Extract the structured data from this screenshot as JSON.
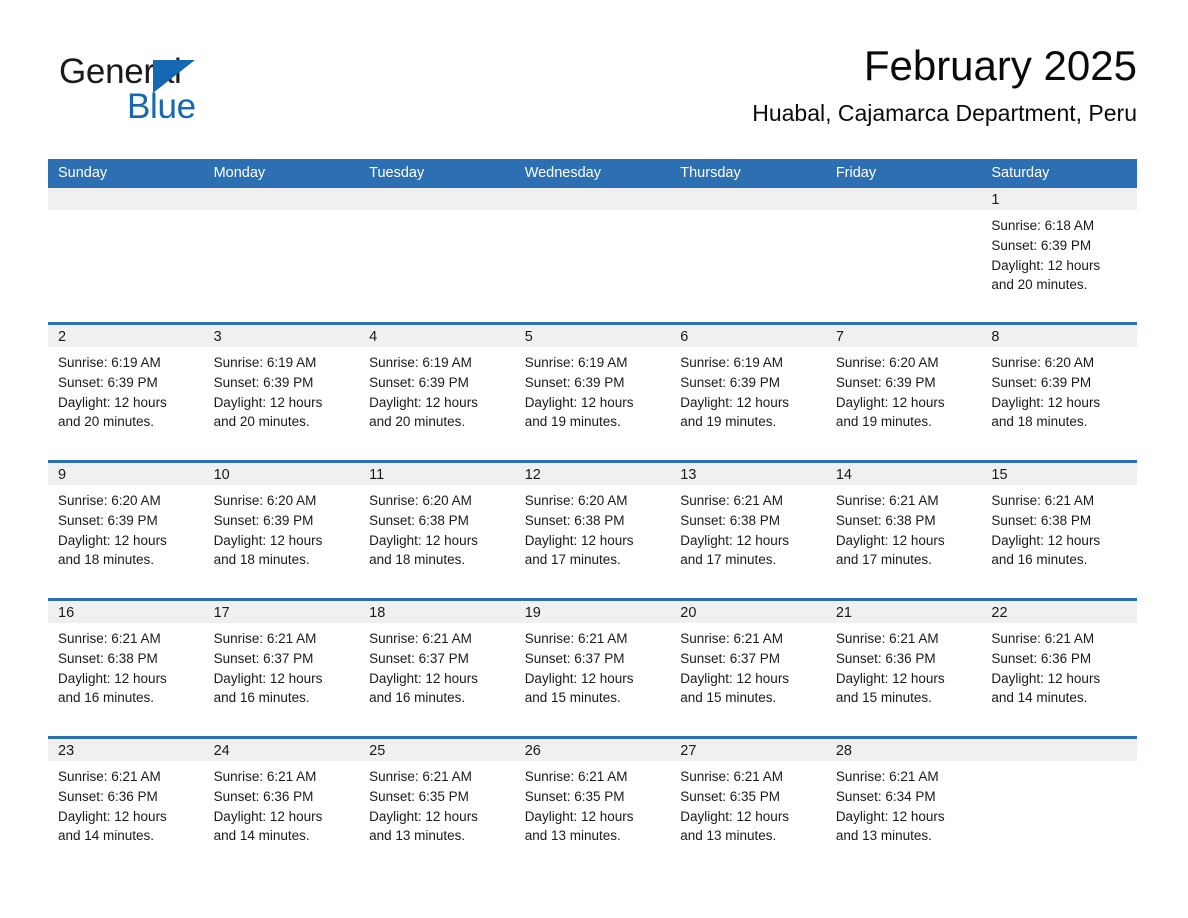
{
  "brand": {
    "name_part1": "General",
    "name_part2": "Blue",
    "triangle_color": "#1668b3"
  },
  "header": {
    "title": "February 2025",
    "subtitle": "Huabal, Cajamarca Department, Peru"
  },
  "theme": {
    "header_blue": "#2d6fb3",
    "daynum_band": "#f0f0f0",
    "text": "#1a1a1a",
    "page_background": "#ffffff"
  },
  "weekdays": [
    "Sunday",
    "Monday",
    "Tuesday",
    "Wednesday",
    "Thursday",
    "Friday",
    "Saturday"
  ],
  "labels": {
    "sunrise_prefix": "Sunrise:",
    "sunset_prefix": "Sunset:",
    "daylight_prefix": "Daylight:"
  },
  "weeks": [
    [
      {
        "day": "",
        "empty": true
      },
      {
        "day": "",
        "empty": true
      },
      {
        "day": "",
        "empty": true
      },
      {
        "day": "",
        "empty": true
      },
      {
        "day": "",
        "empty": true
      },
      {
        "day": "",
        "empty": true
      },
      {
        "day": "1",
        "sunrise": "Sunrise: 6:18 AM",
        "sunset": "Sunset: 6:39 PM",
        "daylight_line1": "Daylight: 12 hours",
        "daylight_line2": "and 20 minutes."
      }
    ],
    [
      {
        "day": "2",
        "sunrise": "Sunrise: 6:19 AM",
        "sunset": "Sunset: 6:39 PM",
        "daylight_line1": "Daylight: 12 hours",
        "daylight_line2": "and 20 minutes."
      },
      {
        "day": "3",
        "sunrise": "Sunrise: 6:19 AM",
        "sunset": "Sunset: 6:39 PM",
        "daylight_line1": "Daylight: 12 hours",
        "daylight_line2": "and 20 minutes."
      },
      {
        "day": "4",
        "sunrise": "Sunrise: 6:19 AM",
        "sunset": "Sunset: 6:39 PM",
        "daylight_line1": "Daylight: 12 hours",
        "daylight_line2": "and 20 minutes."
      },
      {
        "day": "5",
        "sunrise": "Sunrise: 6:19 AM",
        "sunset": "Sunset: 6:39 PM",
        "daylight_line1": "Daylight: 12 hours",
        "daylight_line2": "and 19 minutes."
      },
      {
        "day": "6",
        "sunrise": "Sunrise: 6:19 AM",
        "sunset": "Sunset: 6:39 PM",
        "daylight_line1": "Daylight: 12 hours",
        "daylight_line2": "and 19 minutes."
      },
      {
        "day": "7",
        "sunrise": "Sunrise: 6:20 AM",
        "sunset": "Sunset: 6:39 PM",
        "daylight_line1": "Daylight: 12 hours",
        "daylight_line2": "and 19 minutes."
      },
      {
        "day": "8",
        "sunrise": "Sunrise: 6:20 AM",
        "sunset": "Sunset: 6:39 PM",
        "daylight_line1": "Daylight: 12 hours",
        "daylight_line2": "and 18 minutes."
      }
    ],
    [
      {
        "day": "9",
        "sunrise": "Sunrise: 6:20 AM",
        "sunset": "Sunset: 6:39 PM",
        "daylight_line1": "Daylight: 12 hours",
        "daylight_line2": "and 18 minutes."
      },
      {
        "day": "10",
        "sunrise": "Sunrise: 6:20 AM",
        "sunset": "Sunset: 6:39 PM",
        "daylight_line1": "Daylight: 12 hours",
        "daylight_line2": "and 18 minutes."
      },
      {
        "day": "11",
        "sunrise": "Sunrise: 6:20 AM",
        "sunset": "Sunset: 6:38 PM",
        "daylight_line1": "Daylight: 12 hours",
        "daylight_line2": "and 18 minutes."
      },
      {
        "day": "12",
        "sunrise": "Sunrise: 6:20 AM",
        "sunset": "Sunset: 6:38 PM",
        "daylight_line1": "Daylight: 12 hours",
        "daylight_line2": "and 17 minutes."
      },
      {
        "day": "13",
        "sunrise": "Sunrise: 6:21 AM",
        "sunset": "Sunset: 6:38 PM",
        "daylight_line1": "Daylight: 12 hours",
        "daylight_line2": "and 17 minutes."
      },
      {
        "day": "14",
        "sunrise": "Sunrise: 6:21 AM",
        "sunset": "Sunset: 6:38 PM",
        "daylight_line1": "Daylight: 12 hours",
        "daylight_line2": "and 17 minutes."
      },
      {
        "day": "15",
        "sunrise": "Sunrise: 6:21 AM",
        "sunset": "Sunset: 6:38 PM",
        "daylight_line1": "Daylight: 12 hours",
        "daylight_line2": "and 16 minutes."
      }
    ],
    [
      {
        "day": "16",
        "sunrise": "Sunrise: 6:21 AM",
        "sunset": "Sunset: 6:38 PM",
        "daylight_line1": "Daylight: 12 hours",
        "daylight_line2": "and 16 minutes."
      },
      {
        "day": "17",
        "sunrise": "Sunrise: 6:21 AM",
        "sunset": "Sunset: 6:37 PM",
        "daylight_line1": "Daylight: 12 hours",
        "daylight_line2": "and 16 minutes."
      },
      {
        "day": "18",
        "sunrise": "Sunrise: 6:21 AM",
        "sunset": "Sunset: 6:37 PM",
        "daylight_line1": "Daylight: 12 hours",
        "daylight_line2": "and 16 minutes."
      },
      {
        "day": "19",
        "sunrise": "Sunrise: 6:21 AM",
        "sunset": "Sunset: 6:37 PM",
        "daylight_line1": "Daylight: 12 hours",
        "daylight_line2": "and 15 minutes."
      },
      {
        "day": "20",
        "sunrise": "Sunrise: 6:21 AM",
        "sunset": "Sunset: 6:37 PM",
        "daylight_line1": "Daylight: 12 hours",
        "daylight_line2": "and 15 minutes."
      },
      {
        "day": "21",
        "sunrise": "Sunrise: 6:21 AM",
        "sunset": "Sunset: 6:36 PM",
        "daylight_line1": "Daylight: 12 hours",
        "daylight_line2": "and 15 minutes."
      },
      {
        "day": "22",
        "sunrise": "Sunrise: 6:21 AM",
        "sunset": "Sunset: 6:36 PM",
        "daylight_line1": "Daylight: 12 hours",
        "daylight_line2": "and 14 minutes."
      }
    ],
    [
      {
        "day": "23",
        "sunrise": "Sunrise: 6:21 AM",
        "sunset": "Sunset: 6:36 PM",
        "daylight_line1": "Daylight: 12 hours",
        "daylight_line2": "and 14 minutes."
      },
      {
        "day": "24",
        "sunrise": "Sunrise: 6:21 AM",
        "sunset": "Sunset: 6:36 PM",
        "daylight_line1": "Daylight: 12 hours",
        "daylight_line2": "and 14 minutes."
      },
      {
        "day": "25",
        "sunrise": "Sunrise: 6:21 AM",
        "sunset": "Sunset: 6:35 PM",
        "daylight_line1": "Daylight: 12 hours",
        "daylight_line2": "and 13 minutes."
      },
      {
        "day": "26",
        "sunrise": "Sunrise: 6:21 AM",
        "sunset": "Sunset: 6:35 PM",
        "daylight_line1": "Daylight: 12 hours",
        "daylight_line2": "and 13 minutes."
      },
      {
        "day": "27",
        "sunrise": "Sunrise: 6:21 AM",
        "sunset": "Sunset: 6:35 PM",
        "daylight_line1": "Daylight: 12 hours",
        "daylight_line2": "and 13 minutes."
      },
      {
        "day": "28",
        "sunrise": "Sunrise: 6:21 AM",
        "sunset": "Sunset: 6:34 PM",
        "daylight_line1": "Daylight: 12 hours",
        "daylight_line2": "and 13 minutes."
      },
      {
        "day": "",
        "empty": true
      }
    ]
  ]
}
